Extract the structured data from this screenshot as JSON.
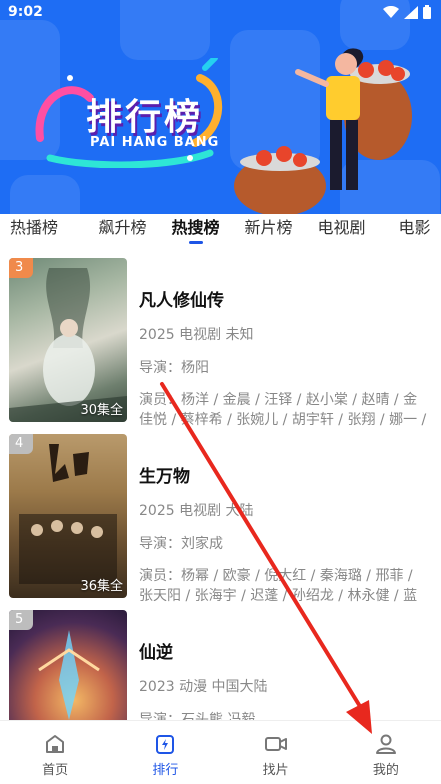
{
  "status_bar": {
    "time": "9:02"
  },
  "banner": {
    "title": "排行榜",
    "subtitle": "PAI HANG BANG",
    "background": "#1e6df4"
  },
  "tabs": [
    {
      "label": "热播榜",
      "active": false
    },
    {
      "label": "飙升榜",
      "active": false
    },
    {
      "label": "热搜榜",
      "active": true
    },
    {
      "label": "新片榜",
      "active": false
    },
    {
      "label": "电视剧",
      "active": false
    },
    {
      "label": "电影",
      "active": false
    }
  ],
  "items": [
    {
      "rank": "3",
      "rank_color": "#f08a4b",
      "episodes": "30集全",
      "title": "凡人修仙传",
      "meta": "2025 电视剧 未知",
      "director": "导演：杨阳",
      "cast": "演员：杨洋 / 金晨 / 汪铎 / 赵小棠 / 赵晴 / 金佳悦 / 蔡梓希 / 张婉儿 / 胡宇轩 / 张翔 / 娜一 / ..."
    },
    {
      "rank": "4",
      "rank_color": "#bdbdbd",
      "episodes": "36集全",
      "title": "生万物",
      "meta": "2025 电视剧 大陆",
      "director": "导演：刘家成",
      "cast": "演员：杨幂 / 欧豪 / 倪大红 / 秦海璐 / 邢菲 / 张天阳 / 张海宇 / 迟蓬 / 孙绍龙 / 林永健 / 蓝盈..."
    },
    {
      "rank": "5",
      "rank_color": "#bdbdbd",
      "episodes": "",
      "title": "仙逆",
      "meta": "2023 动漫 中国大陆",
      "director": "导演：石头熊,冯毅",
      "cast": ""
    }
  ],
  "bottom_nav": [
    {
      "label": "首页",
      "icon": "home-icon",
      "active": false
    },
    {
      "label": "排行",
      "icon": "ranking-icon",
      "active": true
    },
    {
      "label": "找片",
      "icon": "video-camera-icon",
      "active": false
    },
    {
      "label": "我的",
      "icon": "profile-icon",
      "active": false
    }
  ],
  "colors": {
    "accent": "#1e55e6",
    "annotation_arrow": "#e8281e"
  }
}
